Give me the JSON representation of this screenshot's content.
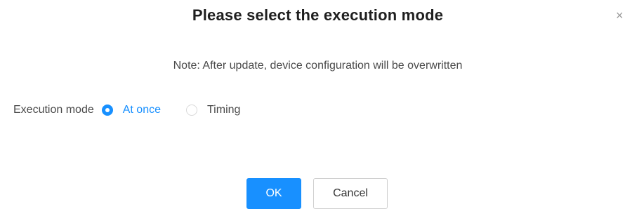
{
  "dialog": {
    "title": "Please select the execution mode",
    "close_glyph": "×",
    "note": "Note: After update, device configuration will be overwritten",
    "mode": {
      "label": "Execution mode",
      "options": [
        {
          "label": "At once",
          "checked": true
        },
        {
          "label": "Timing",
          "checked": false
        }
      ]
    },
    "buttons": {
      "ok_label": "OK",
      "cancel_label": "Cancel"
    }
  },
  "colors": {
    "primary": "#1890ff",
    "text": "#333333",
    "muted": "#9a9a9a"
  },
  "icons": {
    "close": "close-icon"
  }
}
